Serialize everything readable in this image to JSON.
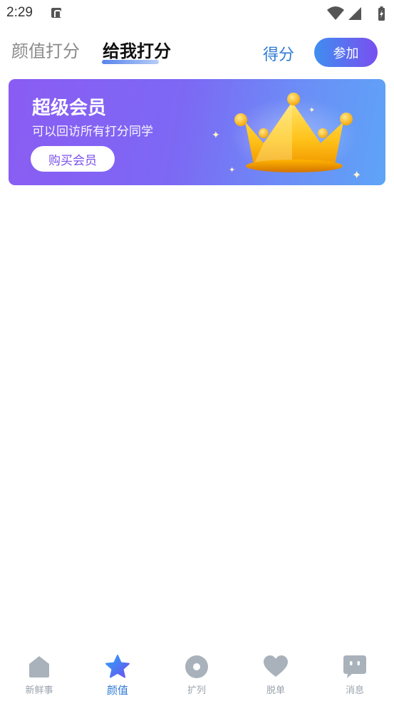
{
  "status_bar": {
    "time": "2:29"
  },
  "header": {
    "tab_rate_looks": "颜值打分",
    "tab_rate_me": "给我打分",
    "score_link": "得分",
    "join_button": "参加"
  },
  "vip_banner": {
    "title": "超级会员",
    "subtitle": "可以回访所有打分同学",
    "buy_button": "购买会员"
  },
  "bottom_nav": {
    "items": [
      {
        "label": "新鲜事",
        "icon": "home-icon"
      },
      {
        "label": "颜值",
        "icon": "star-icon"
      },
      {
        "label": "扩列",
        "icon": "ring-icon"
      },
      {
        "label": "脱单",
        "icon": "heart-icon"
      },
      {
        "label": "消息",
        "icon": "chat-bubble-icon"
      }
    ],
    "active_index": 1
  },
  "colors": {
    "accent": "#2f7ad6",
    "inactive": "#9aa3ad",
    "banner_start": "#8a5cf3",
    "banner_end": "#5ea4f8"
  }
}
